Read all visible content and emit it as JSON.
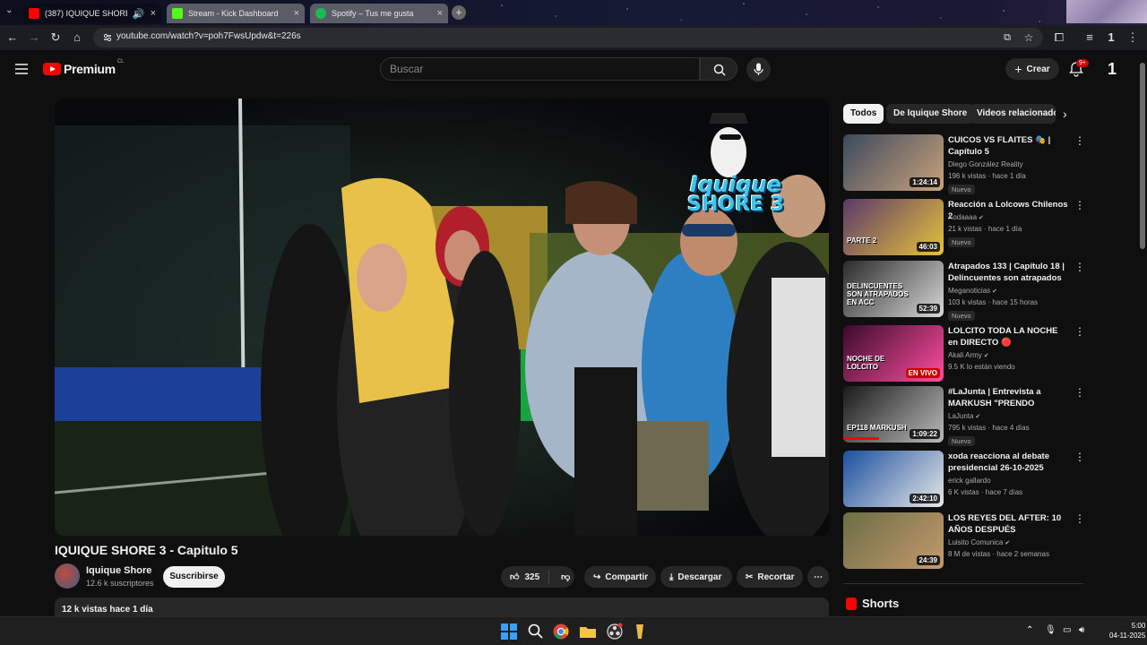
{
  "browser": {
    "tabs": [
      {
        "title": "(387) IQUIQUE SHORE 3",
        "favicon": "youtube-icon",
        "color": "#ff0000"
      },
      {
        "title": "Stream - Kick Dashboard",
        "favicon": "kick-icon",
        "color": "#53fc18"
      },
      {
        "title": "Spotify – Tus me gusta",
        "favicon": "spotify-icon",
        "color": "#1db954"
      }
    ],
    "url": "youtube.com/watch?v=poh7FwsUpdw&t=226s"
  },
  "header": {
    "logo_text": "Premium",
    "region": "CL",
    "search_placeholder": "Buscar",
    "create_label": "Crear",
    "notifications_badge": "9+"
  },
  "video": {
    "overlay_logo_line1": "Iquique",
    "overlay_logo_line2": "SHORE 3",
    "title": "IQUIQUE SHORE 3 - Capitulo 5",
    "channel": "Iquique Shore",
    "subscribers": "12.6 k suscriptores",
    "subscribe_label": "Suscribirse",
    "likes": "325",
    "share_label": "Compartir",
    "download_label": "Descargar",
    "clip_label": "Recortar",
    "views_date": "12 k vistas  hace 1 día"
  },
  "chips": [
    "Todos",
    "De Iquique Shore",
    "Videos relacionados"
  ],
  "recommendations": [
    {
      "title": "CUICOS VS FLAITES 🎭 | Capítulo 5",
      "channel": "Diego González Reality",
      "meta": "196 k vistas · hace 1 día",
      "duration": "1:24:14",
      "badge": "Nuevo",
      "verified": false
    },
    {
      "title": "Reacción a Lolcows Chilenos 2",
      "channel": "Xodaaaa",
      "meta": "21 k vistas · hace 1 día",
      "duration": "46:03",
      "badge": "Nuevo",
      "verified": true
    },
    {
      "title": "Atrapados 133 | Capítulo 18 | Delincuentes son atrapados e...",
      "channel": "Meganoticias",
      "meta": "103 k vistas · hace 15 horas",
      "duration": "52:39",
      "badge": "Nuevo",
      "verified": true
    },
    {
      "title": "LOLCITO TODA LA NOCHE en DIRECTO 🔴",
      "channel": "Akali Army",
      "meta": "9.5 K lo están viendo",
      "duration": "EN VIVO",
      "badge": "",
      "verified": true
    },
    {
      "title": "#LaJunta | Entrevista a MARKUSH \"PRENDO STREAM...",
      "channel": "LaJunta",
      "meta": "795 k vistas · hace 4 días",
      "duration": "1:09:22",
      "badge": "Nuevo",
      "verified": true
    },
    {
      "title": "xoda reacciona al debate presidencial 26-10-2025",
      "channel": "erick gallardo",
      "meta": "6 K vistas · hace 7 días",
      "duration": "2:42:10",
      "badge": "",
      "verified": false
    },
    {
      "title": "LOS REYES DEL AFTER: 10 AÑOS DESPUÉS",
      "channel": "Luisito Comunica",
      "meta": "8 M de vistas · hace 2 semanas",
      "duration": "24:39",
      "badge": "",
      "verified": true
    }
  ],
  "thumb_colors": [
    [
      "#3b4a5e",
      "#c9a27c"
    ],
    [
      "#5a3a6a",
      "#e6c23a"
    ],
    [
      "#2a2a2a",
      "#d9d9d9"
    ],
    [
      "#3a0a2a",
      "#ff4fa0"
    ],
    [
      "#1a1a1a",
      "#bbbbbb"
    ],
    [
      "#1a4fa0",
      "#e8e8e8"
    ],
    [
      "#6b6e45",
      "#c49a6c"
    ]
  ],
  "thumb_texts": [
    "",
    "PARTE 2",
    "DELINCUENTES SON ATRAPADOS EN ACC",
    "NOCHE DE LOLCITO",
    "EP118 MARKUSH",
    "",
    ""
  ],
  "shorts_title": "Shorts",
  "taskbar": {
    "time": "5:00",
    "date": "04-11-2025"
  }
}
